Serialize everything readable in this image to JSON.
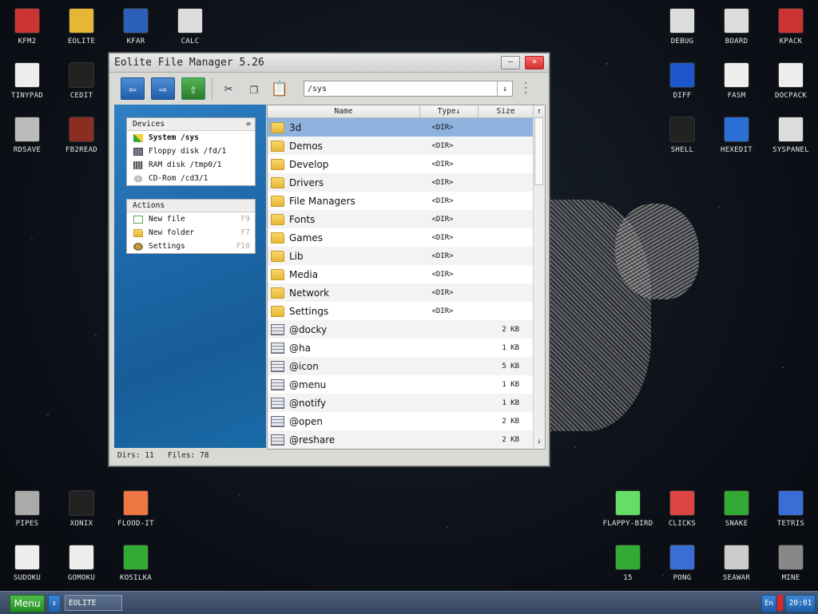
{
  "desktop": {
    "left_top": [
      {
        "label": "KFM2",
        "icon": "floppy-icon"
      },
      {
        "label": "EOLITE",
        "icon": "folder-icon"
      },
      {
        "label": "KFAR",
        "icon": "kfar-icon"
      },
      {
        "label": "CALC",
        "icon": "calculator-icon"
      },
      {
        "label": "TINYPAD",
        "icon": "notepad-icon"
      },
      {
        "label": "CEDIT",
        "icon": "code-icon"
      },
      {
        "label": "RDSAVE",
        "icon": "rdsave-icon"
      },
      {
        "label": "FB2READ",
        "icon": "book-icon"
      }
    ],
    "right_top": [
      {
        "label": "DEBUG",
        "icon": "debug-icon"
      },
      {
        "label": "BOARD",
        "icon": "board-icon"
      },
      {
        "label": "KPACK",
        "icon": "kpack-icon"
      },
      {
        "label": "DIFF",
        "icon": "diff-icon"
      },
      {
        "label": "FASM",
        "icon": "fasm-icon"
      },
      {
        "label": "DOCPACK",
        "icon": "docpack-icon"
      },
      {
        "label": "SHELL",
        "icon": "terminal-icon"
      },
      {
        "label": "HEXEDIT",
        "icon": "hexedit-icon"
      },
      {
        "label": "SYSPANEL",
        "icon": "syspanel-icon"
      }
    ],
    "left_bottom": [
      {
        "label": "PIPES",
        "icon": "pipes-icon"
      },
      {
        "label": "XONIX",
        "icon": "xonix-icon"
      },
      {
        "label": "FLOOD-IT",
        "icon": "flood-it-icon"
      },
      {
        "label": "SUDOKU",
        "icon": "sudoku-icon"
      },
      {
        "label": "GOMOKU",
        "icon": "gomoku-icon"
      },
      {
        "label": "KOSILKA",
        "icon": "lawnmower-icon"
      }
    ],
    "right_bottom": [
      {
        "label": "FLAPPY-BIRD",
        "icon": "bird-icon"
      },
      {
        "label": "CLICKS",
        "icon": "clicks-icon"
      },
      {
        "label": "SNAKE",
        "icon": "snake-icon"
      },
      {
        "label": "TETRIS",
        "icon": "tetris-icon"
      },
      {
        "label": "15",
        "icon": "fifteen-icon"
      },
      {
        "label": "PONG",
        "icon": "pong-icon"
      },
      {
        "label": "SEAWAR",
        "icon": "ship-icon"
      },
      {
        "label": "MINE",
        "icon": "mine-icon"
      }
    ]
  },
  "window": {
    "title": "Eolite File Manager 5.26",
    "path": "/sys",
    "path_dropdown": "↓",
    "devices": {
      "header": "Devices",
      "collapse": "=",
      "items": [
        {
          "label": "System /sys",
          "icon": "system-icon"
        },
        {
          "label": "Floppy disk /fd/1",
          "icon": "floppy-icon"
        },
        {
          "label": "RAM disk /tmp0/1",
          "icon": "ram-disk-icon"
        },
        {
          "label": "CD-Rom /cd3/1",
          "icon": "cdrom-icon"
        }
      ]
    },
    "actions": {
      "header": "Actions",
      "items": [
        {
          "label": "New file",
          "key": "F9"
        },
        {
          "label": "New folder",
          "key": "F7"
        },
        {
          "label": "Settings",
          "key": "F10"
        }
      ]
    },
    "columns": {
      "name": "Name",
      "type": "Type↓",
      "size": "Size"
    },
    "rows": [
      {
        "name": "3d",
        "type": "<DIR>",
        "size": "",
        "kind": "folder"
      },
      {
        "name": "Demos",
        "type": "<DIR>",
        "size": "",
        "kind": "folder"
      },
      {
        "name": "Develop",
        "type": "<DIR>",
        "size": "",
        "kind": "folder"
      },
      {
        "name": "Drivers",
        "type": "<DIR>",
        "size": "",
        "kind": "folder"
      },
      {
        "name": "File Managers",
        "type": "<DIR>",
        "size": "",
        "kind": "folder"
      },
      {
        "name": "Fonts",
        "type": "<DIR>",
        "size": "",
        "kind": "folder"
      },
      {
        "name": "Games",
        "type": "<DIR>",
        "size": "",
        "kind": "folder"
      },
      {
        "name": "Lib",
        "type": "<DIR>",
        "size": "",
        "kind": "folder"
      },
      {
        "name": "Media",
        "type": "<DIR>",
        "size": "",
        "kind": "folder"
      },
      {
        "name": "Network",
        "type": "<DIR>",
        "size": "",
        "kind": "folder"
      },
      {
        "name": "Settings",
        "type": "<DIR>",
        "size": "",
        "kind": "folder"
      },
      {
        "name": "@docky",
        "type": "",
        "size": "2 KB",
        "kind": "file"
      },
      {
        "name": "@ha",
        "type": "",
        "size": "1 KB",
        "kind": "file"
      },
      {
        "name": "@icon",
        "type": "",
        "size": "5 KB",
        "kind": "file"
      },
      {
        "name": "@menu",
        "type": "",
        "size": "1 KB",
        "kind": "file"
      },
      {
        "name": "@notify",
        "type": "",
        "size": "1 KB",
        "kind": "file"
      },
      {
        "name": "@open",
        "type": "",
        "size": "2 KB",
        "kind": "file"
      },
      {
        "name": "@reshare",
        "type": "",
        "size": "2 KB",
        "kind": "file"
      }
    ],
    "status": {
      "dirs": "Dirs: 11",
      "files": "Files: 78"
    }
  },
  "taskbar": {
    "menu": "Menu",
    "switch": "↕",
    "task": "EOLITE",
    "lang": "En",
    "clock": "20:01"
  }
}
